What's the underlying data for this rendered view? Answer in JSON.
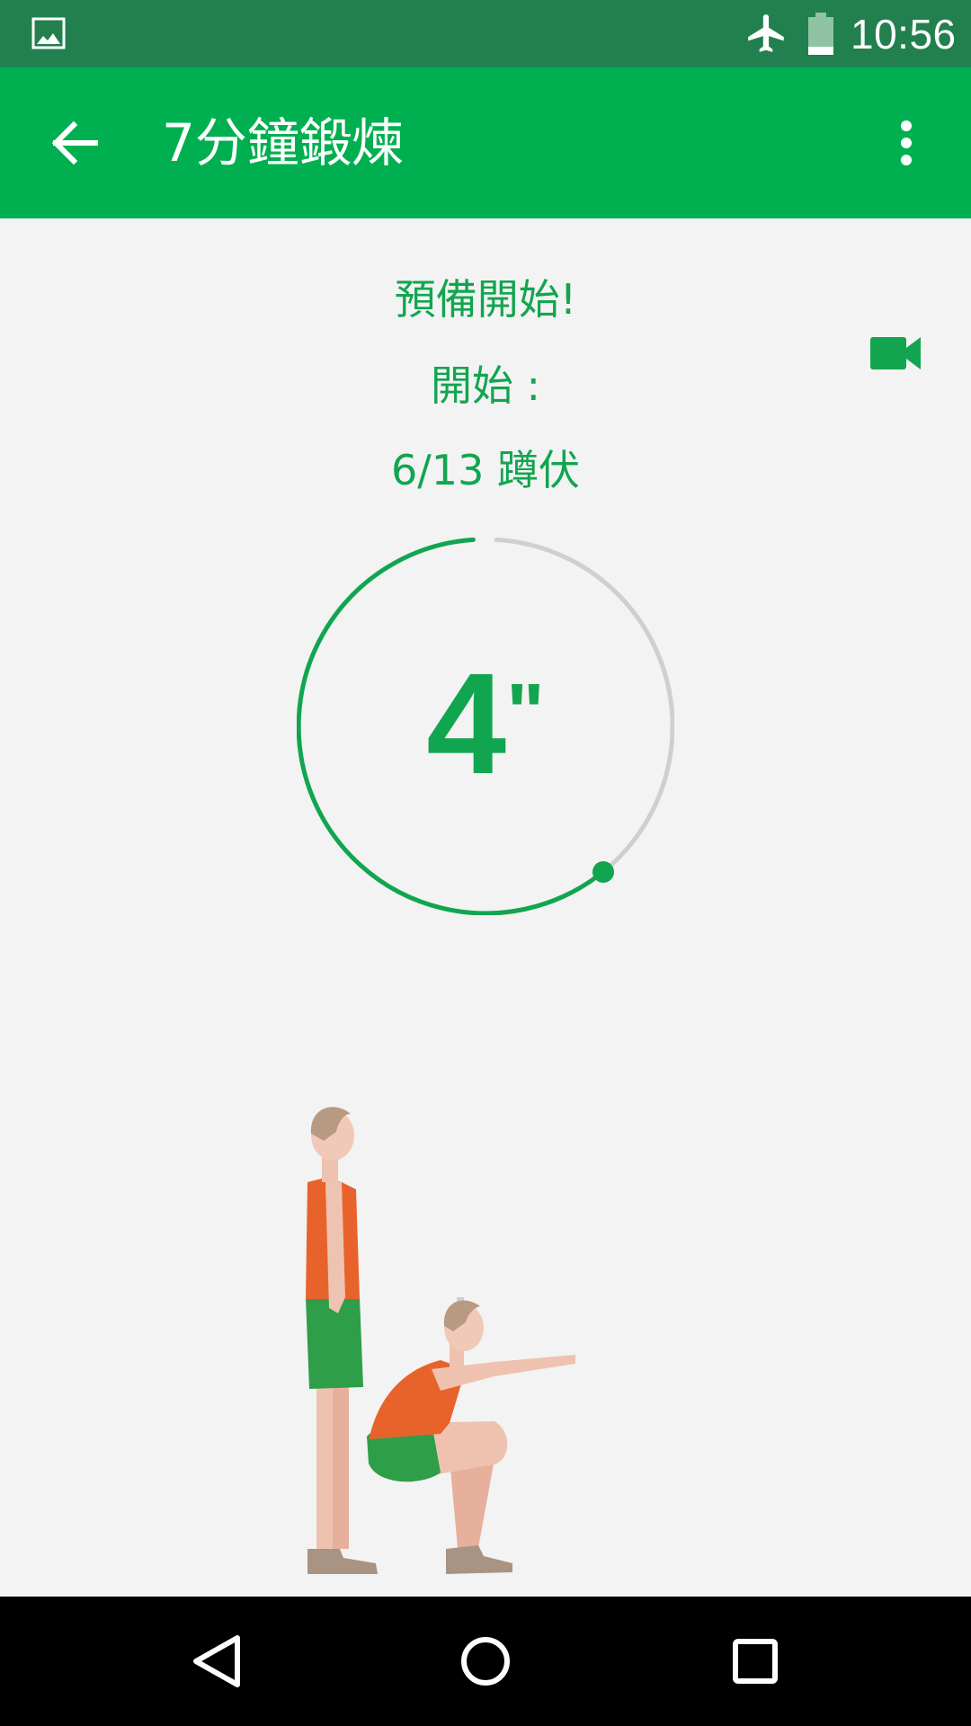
{
  "status_bar": {
    "time": "10:56",
    "left_icon": "image-icon",
    "icons": [
      "airplane-icon",
      "battery-icon"
    ]
  },
  "toolbar": {
    "title": "7分鐘鍛煉",
    "back_icon": "arrow-back-icon",
    "menu_icon": "more-vert-icon"
  },
  "main": {
    "ready_text": "預備開始!",
    "start_text": "開始 :",
    "exercise_text": "6/13 蹲伏",
    "video_icon": "video-camera-icon",
    "timer": {
      "value": "4",
      "unit": "\"",
      "progress": 0.62
    },
    "illustration": "squat-exercise-illustration"
  },
  "nav_bar": {
    "buttons": [
      "back-triangle-icon",
      "home-circle-icon",
      "recents-square-icon"
    ]
  },
  "colors": {
    "status_bar": "#21804e",
    "toolbar": "#00b050",
    "accent": "#12a550",
    "background": "#f3f3f3",
    "track": "#cfcfcf"
  }
}
